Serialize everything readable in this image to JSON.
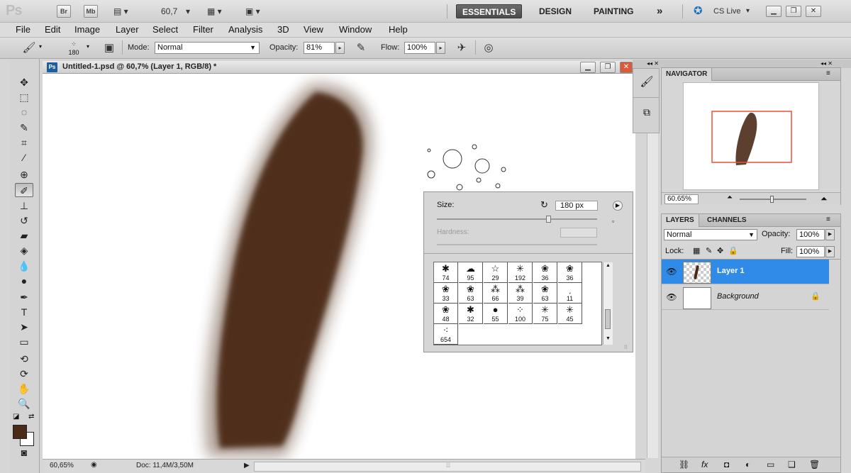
{
  "appbar": {
    "logo": "Ps",
    "bridge": "Br",
    "minibridge": "Mb",
    "zoom": "60,7",
    "workspaces": [
      "ESSENTIALS",
      "DESIGN",
      "PAINTING"
    ],
    "more": "»",
    "cslive": "CS Live"
  },
  "menu": [
    "File",
    "Edit",
    "Image",
    "Layer",
    "Select",
    "Filter",
    "Analysis",
    "3D",
    "View",
    "Window",
    "Help"
  ],
  "options": {
    "brush_size": "180",
    "mode_label": "Mode:",
    "mode_value": "Normal",
    "opacity_label": "Opacity:",
    "opacity_value": "81%",
    "flow_label": "Flow:",
    "flow_value": "100%"
  },
  "document": {
    "badge": "Ps",
    "title": "Untitled-1.psd @ 60,7% (Layer 1, RGB/8) *",
    "zoom_status": "60,65%",
    "doc_status": "Doc: 11,4M/3,50M",
    "stroke_color": "#4b2a18"
  },
  "brush_picker": {
    "size_label": "Size:",
    "size_value": "180 px",
    "hardness_label": "Hardness:",
    "brushes": [
      {
        "sym": "✱",
        "num": "74"
      },
      {
        "sym": "☁",
        "num": "95"
      },
      {
        "sym": "☆",
        "num": "29"
      },
      {
        "sym": "✳",
        "num": "192"
      },
      {
        "sym": "❀",
        "num": "36"
      },
      {
        "sym": "❀",
        "num": "36"
      },
      {
        "sym": "❀",
        "num": "33"
      },
      {
        "sym": "❀",
        "num": "63"
      },
      {
        "sym": "⁂",
        "num": "66"
      },
      {
        "sym": "⁂",
        "num": "39"
      },
      {
        "sym": "❀",
        "num": "63"
      },
      {
        "sym": "ˏ",
        "num": "11"
      },
      {
        "sym": "❀",
        "num": "48"
      },
      {
        "sym": "✱",
        "num": "32"
      },
      {
        "sym": "●",
        "num": "55"
      },
      {
        "sym": "⁘",
        "num": "100"
      },
      {
        "sym": "✳",
        "num": "75"
      },
      {
        "sym": "✳",
        "num": "45"
      },
      {
        "sym": "⁖",
        "num": "654"
      }
    ]
  },
  "navigator": {
    "tab": "NAVIGATOR",
    "zoom": "60.65%"
  },
  "layers": {
    "tabs": [
      "LAYERS",
      "CHANNELS"
    ],
    "blend": "Normal",
    "opacity_label": "Opacity:",
    "opacity_value": "100%",
    "lock_label": "Lock:",
    "fill_label": "Fill:",
    "fill_value": "100%",
    "items": [
      {
        "name": "Layer 1",
        "selected": true
      },
      {
        "name": "Background",
        "selected": false
      }
    ]
  },
  "colors": {
    "foreground": "#4b2a18",
    "background": "#ffffff",
    "selection": "#2f8ae8",
    "nav_frame": "#e8503a"
  }
}
